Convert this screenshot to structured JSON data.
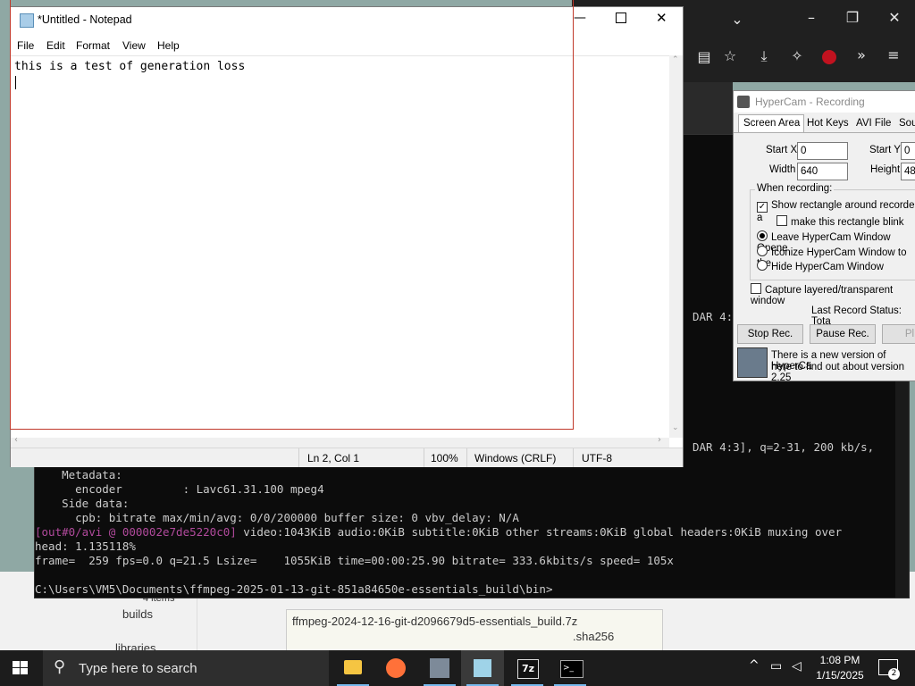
{
  "notepad": {
    "title": "*Untitled - Notepad",
    "menu": [
      "File",
      "Edit",
      "Format",
      "View",
      "Help"
    ],
    "content": "this is a test of generation loss",
    "status": {
      "position": "Ln 2, Col 1",
      "zoom": "100%",
      "line_ending": "Windows (CRLF)",
      "encoding": "UTF-8"
    }
  },
  "hypercam": {
    "title": "HyperCam - Recording",
    "tabs": [
      "Screen Area",
      "Hot Keys",
      "AVI File",
      "Sou"
    ],
    "start_x_label": "Start X",
    "start_x_value": "0",
    "start_y_label": "Start Y",
    "start_y_value": "0",
    "width_label": "Width",
    "width_value": "640",
    "height_label": "Height",
    "height_value": "48",
    "when_recording": "When recording:",
    "show_rect": "Show rectangle around recorded a",
    "blink": "make this rectangle blink",
    "leave_opened": "Leave HyperCam Window Opene",
    "iconize": "Iconize HyperCam Window to the",
    "hide": "Hide HyperCam Window",
    "layered": "Capture layered/transparent window",
    "last_status": "Last Record Status: Tota",
    "stop_btn": "Stop Rec.",
    "pause_btn": "Pause Rec.",
    "play_btn": "Pl",
    "notice_line1": "There is a new version of HyperCa",
    "notice_line2": "here to find out about version 2.25"
  },
  "console": {
    "dar_fragment_1": "DAR 4:",
    "dar_fragment_2": "DAR 4:3], q=2-31, 200 kb/s,",
    "lines": [
      "    Metadata:",
      "      encoder         : Lavc61.31.100 mpeg4",
      "    Side data:",
      "      cpb: bitrate max/min/avg: 0/0/200000 buffer size: 0 vbv_delay: N/A",
      "head: 1.135118%",
      "frame=  259 fps=0.0 q=21.5 Lsize=    1055KiB time=00:00:25.90 bitrate= 333.6kbits/s speed= 105x",
      "",
      "C:\\Users\\VM5\\Documents\\ffmpeg-2025-01-13-git-851a84650e-essentials_build\\bin>"
    ],
    "out_prefix": "[out#0/avi @ 000002e7de5220c0]",
    "out_rest": " video:1043KiB audio:0KiB subtitle:0KiB other streams:0KiB global headers:0KiB muxing over"
  },
  "explorer": {
    "items_count": "4 items",
    "nav_builds": "builds",
    "nav_libraries": "libraries",
    "file_name": "ffmpeg-2024-12-16-git-d2096679d5-essentials_build.7z",
    "file_ext": ".sha256"
  },
  "taskbar": {
    "search_placeholder": "Type here to search",
    "time": "1:08 PM",
    "date": "1/15/2025",
    "notification_count": "2"
  }
}
